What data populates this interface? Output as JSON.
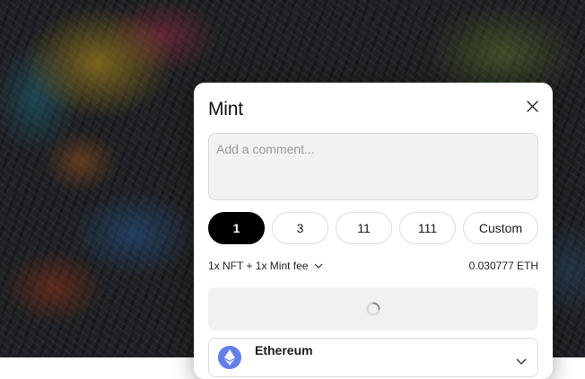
{
  "modal": {
    "title": "Mint",
    "close_icon": "close-icon"
  },
  "comment": {
    "placeholder": "Add a comment...",
    "value": ""
  },
  "quantity": {
    "options": [
      "1",
      "3",
      "11",
      "111",
      "Custom"
    ],
    "selected": "1"
  },
  "summary": {
    "label": "1x NFT + 1x Mint fee",
    "price": "0.030777 ETH",
    "toggle_icon": "chevron-down-icon"
  },
  "mint_button": {
    "state": "loading",
    "icon": "spinner-icon"
  },
  "chain": {
    "name": "Ethereum",
    "icon": "ethereum-icon",
    "expand_icon": "chevron-down-icon"
  },
  "colors": {
    "selected_bg": "#000000",
    "ethereum_brand": "#627eea",
    "field_bg": "#f2f2f2"
  }
}
